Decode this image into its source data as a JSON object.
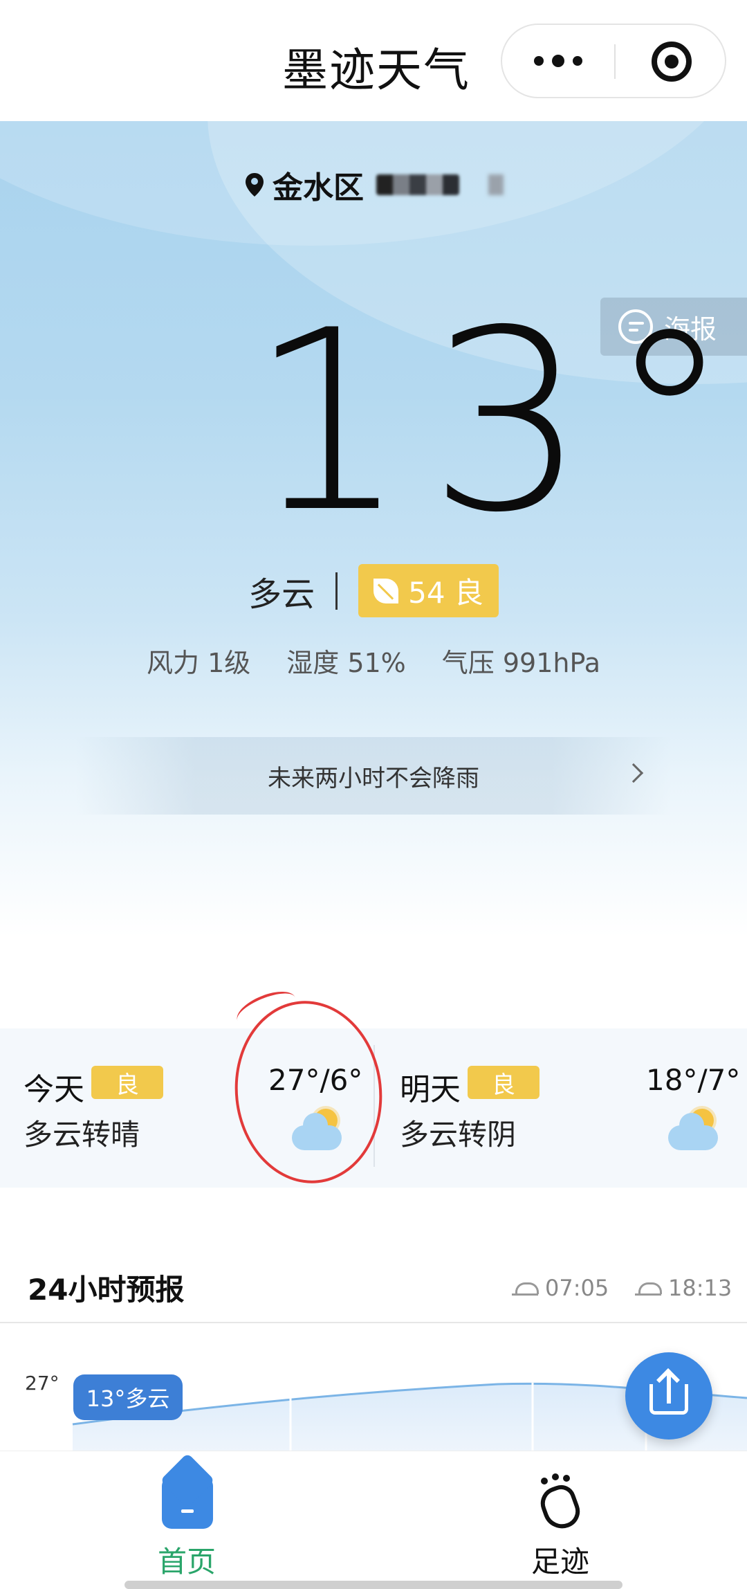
{
  "header": {
    "title": "墨迹天气"
  },
  "hero": {
    "location": "金水区",
    "poster_label": "海报",
    "temperature": "13°",
    "condition": "多云",
    "aqi": "54 良",
    "stats": [
      "风力 1级",
      "湿度 51%",
      "气压 991hPa"
    ],
    "rain_notice": "未来两小时不会降雨"
  },
  "forecast": {
    "today": {
      "day": "今天",
      "aqi": "良",
      "temp": "27°/6°",
      "condition": "多云转晴"
    },
    "tomorrow": {
      "day": "明天",
      "aqi": "良",
      "temp": "18°/7°",
      "condition": "多云转阴"
    }
  },
  "hourly": {
    "title": "24小时预报",
    "sunrise": "07:05",
    "sunset": "18:13",
    "y_label": "27°",
    "now_label": "13°多云"
  },
  "tabbar": {
    "home": "首页",
    "footprint": "足迹"
  },
  "colors": {
    "accent": "#3d89e3",
    "aqi_good": "#f2c94c",
    "active_tab": "#2aa56a"
  }
}
